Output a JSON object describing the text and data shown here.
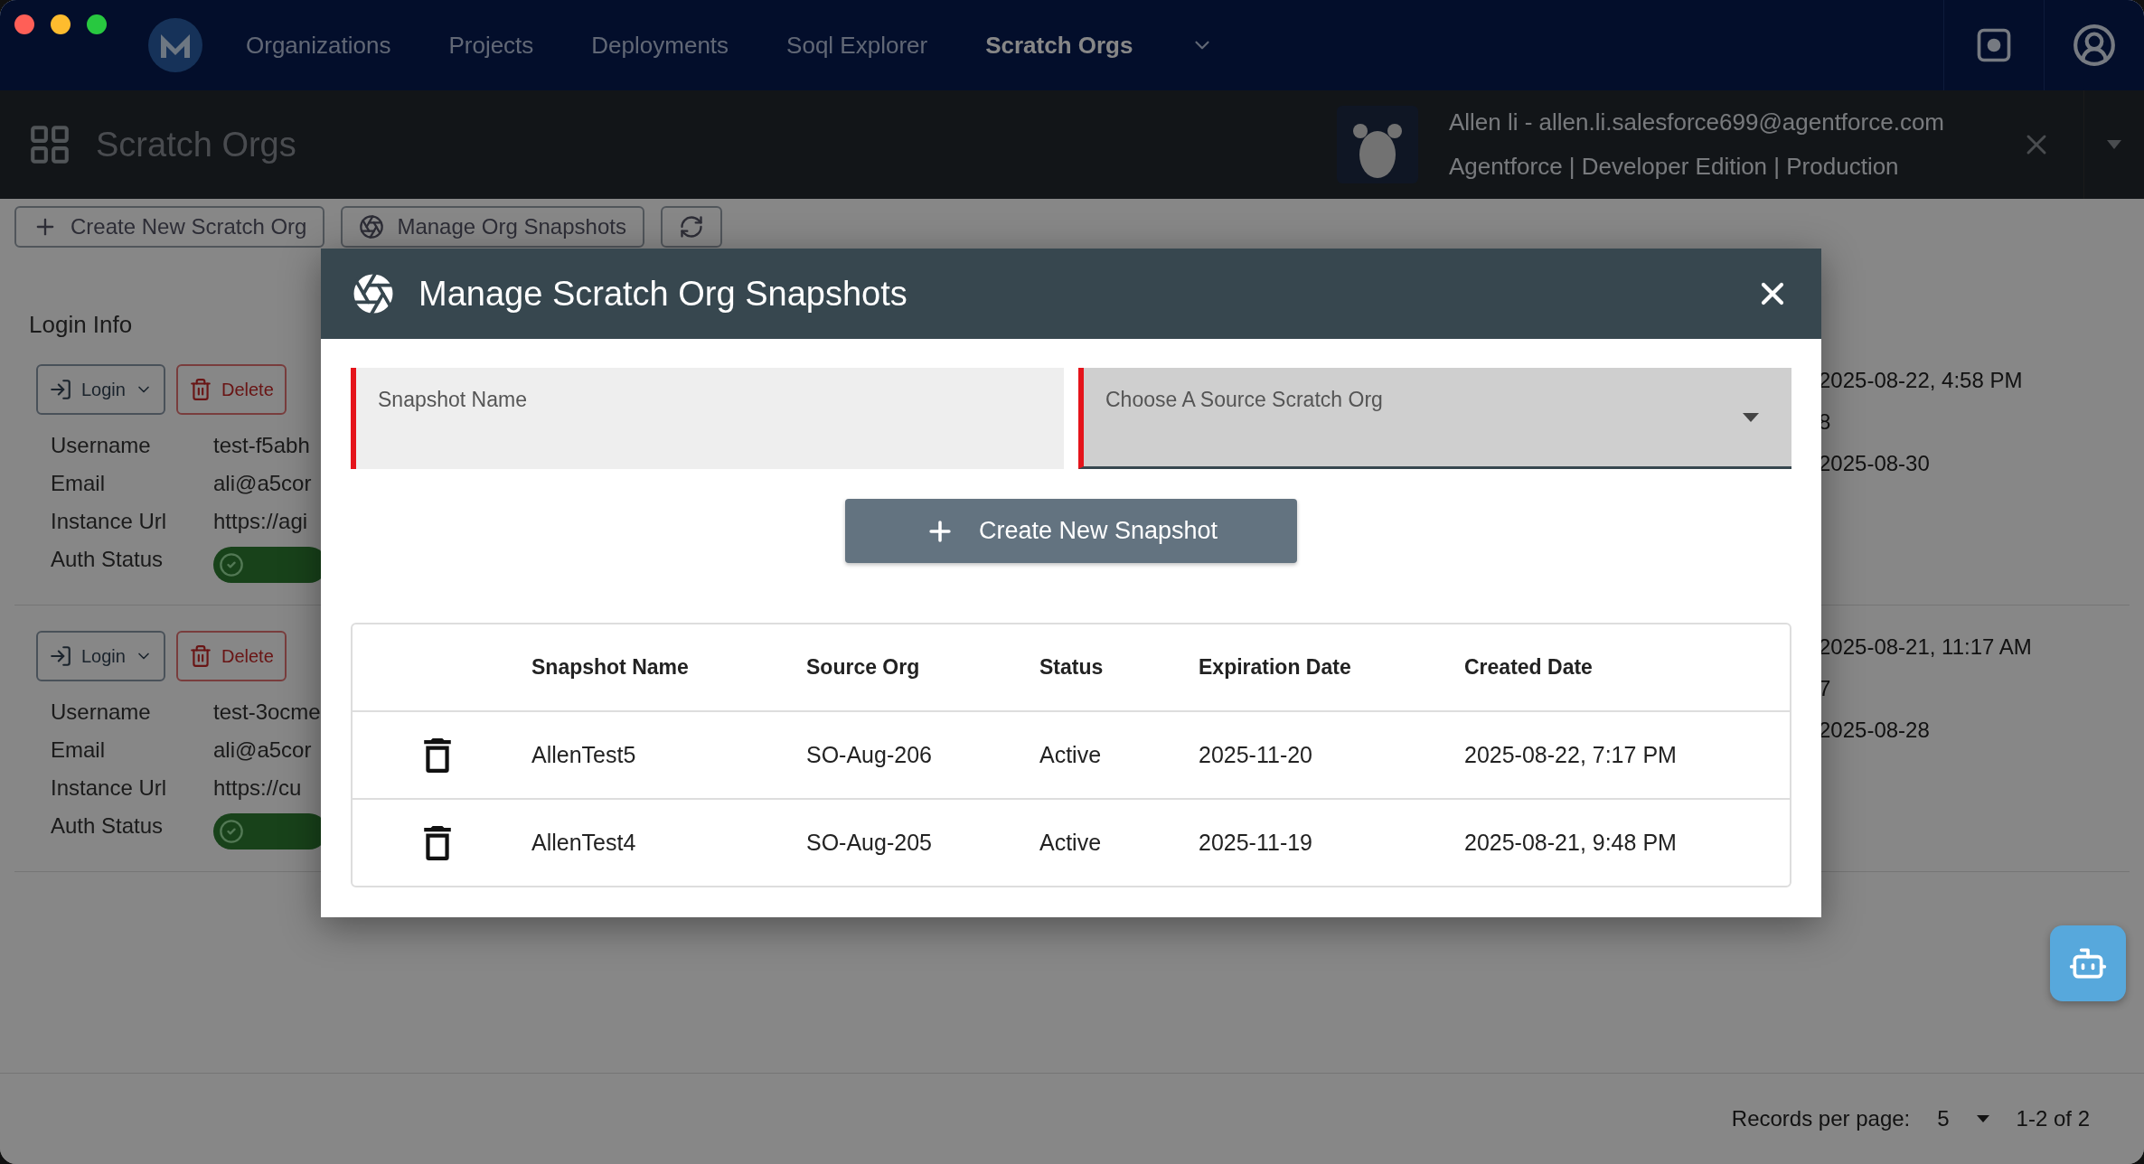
{
  "app_nav": {
    "items": [
      {
        "label": "Organizations",
        "selected": false
      },
      {
        "label": "Projects",
        "selected": false
      },
      {
        "label": "Deployments",
        "selected": false
      },
      {
        "label": "Soql Explorer",
        "selected": false
      },
      {
        "label": "Scratch Orgs",
        "selected": true
      }
    ]
  },
  "page_header": {
    "title": "Scratch Orgs",
    "account_line": "Allen li - allen.li.salesforce699@agentforce.com",
    "org_line": "Agentforce | Developer Edition | Production"
  },
  "toolbar": {
    "buttons": [
      "Create New Scratch Org",
      "Manage Org Snapshots"
    ]
  },
  "section_title": "Login Info",
  "org_cards": [
    {
      "login": "Login",
      "delete": "Delete",
      "fields": [
        {
          "label": "Username",
          "value": "test-f5abh"
        },
        {
          "label": "Email",
          "value": "ali@a5cor"
        },
        {
          "label": "Instance Url",
          "value": "https://agi"
        },
        {
          "label": "Auth Status",
          "kind": "status"
        }
      ],
      "details": [
        "2025-08-22, 4:58 PM",
        "8",
        "2025-08-30"
      ]
    },
    {
      "login": "Login",
      "delete": "Delete",
      "fields": [
        {
          "label": "Username",
          "value": "test-3ocme"
        },
        {
          "label": "Email",
          "value": "ali@a5cor"
        },
        {
          "label": "Instance Url",
          "value": "https://cu"
        },
        {
          "label": "Auth Status",
          "kind": "status"
        }
      ],
      "details": [
        "2025-08-21, 11:17 AM",
        "7",
        "2025-08-28"
      ]
    }
  ],
  "pagination": {
    "label": "Records per page:",
    "per_page": "5",
    "range": "1-2 of 2"
  },
  "dialog": {
    "title": "Manage Scratch Org Snapshots",
    "fields": [
      {
        "kind": "text",
        "label": "Snapshot Name",
        "invalid": true
      },
      {
        "kind": "select",
        "label": "Choose A Source Scratch Org",
        "invalid": true
      }
    ],
    "create_button": "Create New Snapshot",
    "columns": [
      "Snapshot Name",
      "Source Org",
      "Status",
      "Expiration Date",
      "Created Date"
    ],
    "rows": [
      {
        "name": "AllenTest5",
        "source_org": "SO-Aug-206",
        "status": "Active",
        "expiration": "2025-11-20",
        "created": "2025-08-22, 7:17 PM"
      },
      {
        "name": "AllenTest4",
        "source_org": "SO-Aug-205",
        "status": "Active",
        "expiration": "2025-11-19",
        "created": "2025-08-21, 9:48 PM"
      }
    ]
  }
}
